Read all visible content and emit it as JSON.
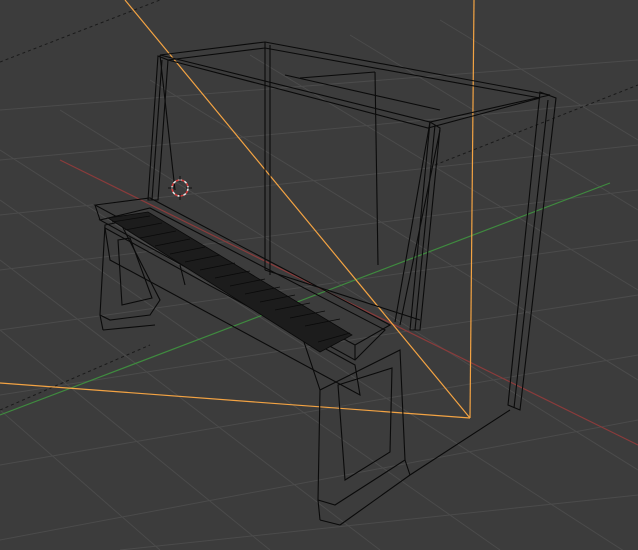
{
  "viewport": {
    "mode": "wireframe",
    "object": "upright-piano",
    "colors": {
      "background": "#3c3c3c",
      "grid": "#4a4a4a",
      "x_axis": "#8a3b3b",
      "y_axis": "#3f8a3f",
      "wireframe": "#000000",
      "selection": "#f3a343",
      "cursor_red": "#d83c3c",
      "cursor_white": "#e8e8e8"
    }
  }
}
